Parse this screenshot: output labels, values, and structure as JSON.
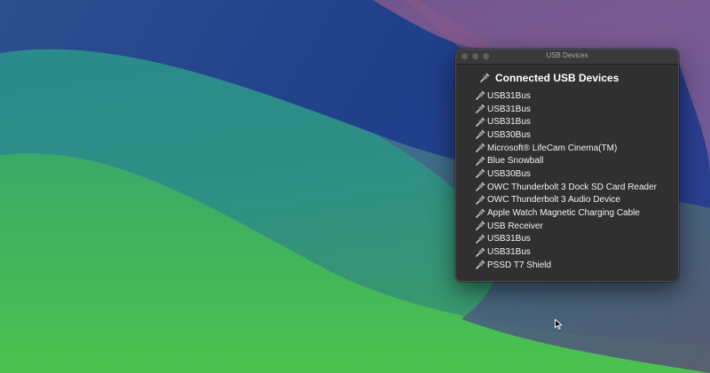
{
  "window": {
    "title": "USB Devices",
    "header": "Connected USB Devices",
    "header_icon": "usb-plug-icon"
  },
  "devices": [
    "USB31Bus",
    "USB31Bus",
    "USB31Bus",
    "USB30Bus",
    "Microsoft® LifeCam Cinema(TM)",
    "Blue Snowball",
    "USB30Bus",
    "OWC Thunderbolt 3 Dock SD Card Reader",
    "OWC Thunderbolt 3 Audio Device",
    "Apple Watch Magnetic Charging Cable",
    "USB Receiver",
    "USB31Bus",
    "USB31Bus",
    "PSSD T7 Shield"
  ],
  "device_icon": "usb-plug-icon",
  "colors": {
    "window_bg": "#303030",
    "titlebar": "#3a3a3a",
    "text": "#f2f2f2"
  }
}
